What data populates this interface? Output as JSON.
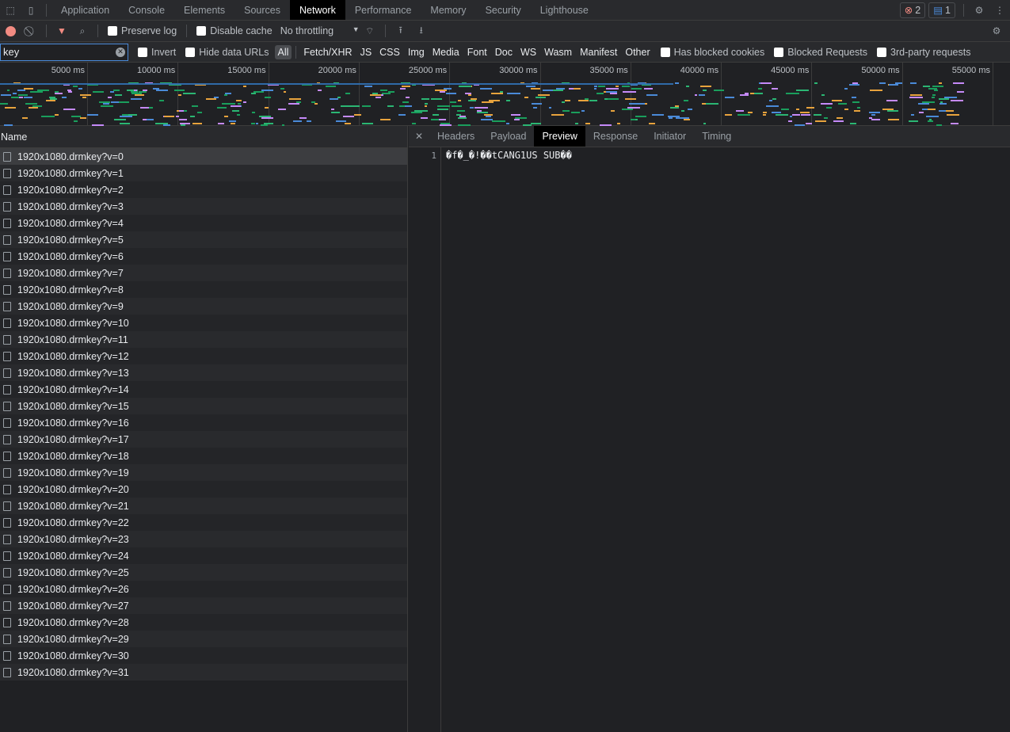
{
  "tabs": [
    "Application",
    "Console",
    "Elements",
    "Sources",
    "Network",
    "Performance",
    "Memory",
    "Security",
    "Lighthouse"
  ],
  "active_tab": "Network",
  "status": {
    "errors": "2",
    "messages": "1"
  },
  "toolbar": {
    "preserve_log": "Preserve log",
    "disable_cache": "Disable cache",
    "throttling": "No throttling"
  },
  "filter": {
    "value": "key",
    "invert": "Invert",
    "hide_data_urls": "Hide data URLs",
    "types": [
      "All",
      "Fetch/XHR",
      "JS",
      "CSS",
      "Img",
      "Media",
      "Font",
      "Doc",
      "WS",
      "Wasm",
      "Manifest",
      "Other"
    ],
    "has_blocked_cookies": "Has blocked cookies",
    "blocked_requests": "Blocked Requests",
    "third_party": "3rd-party requests"
  },
  "overview": {
    "ticks": [
      "5000 ms",
      "10000 ms",
      "15000 ms",
      "20000 ms",
      "25000 ms",
      "30000 ms",
      "35000 ms",
      "40000 ms",
      "45000 ms",
      "50000 ms",
      "55000 ms"
    ]
  },
  "requests": {
    "header": "Name",
    "items": [
      "1920x1080.drmkey?v=0",
      "1920x1080.drmkey?v=1",
      "1920x1080.drmkey?v=2",
      "1920x1080.drmkey?v=3",
      "1920x1080.drmkey?v=4",
      "1920x1080.drmkey?v=5",
      "1920x1080.drmkey?v=6",
      "1920x1080.drmkey?v=7",
      "1920x1080.drmkey?v=8",
      "1920x1080.drmkey?v=9",
      "1920x1080.drmkey?v=10",
      "1920x1080.drmkey?v=11",
      "1920x1080.drmkey?v=12",
      "1920x1080.drmkey?v=13",
      "1920x1080.drmkey?v=14",
      "1920x1080.drmkey?v=15",
      "1920x1080.drmkey?v=16",
      "1920x1080.drmkey?v=17",
      "1920x1080.drmkey?v=18",
      "1920x1080.drmkey?v=19",
      "1920x1080.drmkey?v=20",
      "1920x1080.drmkey?v=21",
      "1920x1080.drmkey?v=22",
      "1920x1080.drmkey?v=23",
      "1920x1080.drmkey?v=24",
      "1920x1080.drmkey?v=25",
      "1920x1080.drmkey?v=26",
      "1920x1080.drmkey?v=27",
      "1920x1080.drmkey?v=28",
      "1920x1080.drmkey?v=29",
      "1920x1080.drmkey?v=30",
      "1920x1080.drmkey?v=31"
    ]
  },
  "detail": {
    "tabs": [
      "Headers",
      "Payload",
      "Preview",
      "Response",
      "Initiator",
      "Timing"
    ],
    "active": "Preview",
    "line_number": "1",
    "content": "�f�_�!��tCANG1US SUB��"
  }
}
